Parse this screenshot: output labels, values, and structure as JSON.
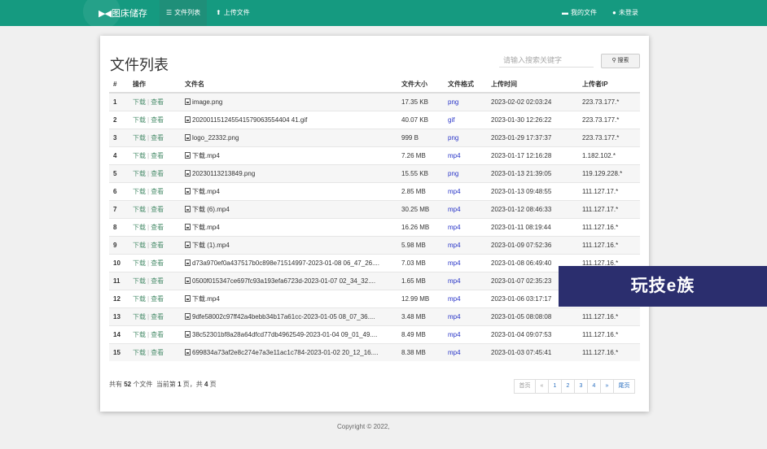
{
  "nav": {
    "brand_logo": "▶◀",
    "brand_text": "图床储存",
    "items": [
      {
        "label": "文件列表",
        "icon": "list-icon"
      },
      {
        "label": "上传文件",
        "icon": "upload-icon"
      }
    ],
    "right": [
      {
        "label": "我的文件",
        "icon": "folder-icon"
      },
      {
        "label": "未登录",
        "icon": "user-icon"
      }
    ]
  },
  "page": {
    "title": "文件列表",
    "search_placeholder": "请输入搜索关键字",
    "search_button": "搜索"
  },
  "table": {
    "headers": [
      "#",
      "操作",
      "文件名",
      "文件大小",
      "文件格式",
      "上传时间",
      "上传者IP"
    ],
    "download_label": "下载",
    "separator": "|",
    "view_label": "查看",
    "rows": [
      {
        "num": "1",
        "name": "image.png",
        "size": "17.35 KB",
        "format": "png",
        "time": "2023-02-02 02:03:24",
        "ip": "223.73.177.*"
      },
      {
        "num": "2",
        "name": "202001151245541579063554404 41.gif",
        "size": "40.07 KB",
        "format": "gif",
        "time": "2023-01-30 12:26:22",
        "ip": "223.73.177.*"
      },
      {
        "num": "3",
        "name": "logo_22332.png",
        "size": "999 B",
        "format": "png",
        "time": "2023-01-29 17:37:37",
        "ip": "223.73.177.*"
      },
      {
        "num": "4",
        "name": "下载.mp4",
        "size": "7.26 MB",
        "format": "mp4",
        "time": "2023-01-17 12:16:28",
        "ip": "1.182.102.*"
      },
      {
        "num": "5",
        "name": "20230113213849.png",
        "size": "15.55 KB",
        "format": "png",
        "time": "2023-01-13 21:39:05",
        "ip": "119.129.228.*"
      },
      {
        "num": "6",
        "name": "下载.mp4",
        "size": "2.85 MB",
        "format": "mp4",
        "time": "2023-01-13 09:48:55",
        "ip": "111.127.17.*"
      },
      {
        "num": "7",
        "name": "下载 (6).mp4",
        "size": "30.25 MB",
        "format": "mp4",
        "time": "2023-01-12 08:46:33",
        "ip": "111.127.17.*"
      },
      {
        "num": "8",
        "name": "下载.mp4",
        "size": "16.26 MB",
        "format": "mp4",
        "time": "2023-01-11 08:19:44",
        "ip": "111.127.16.*"
      },
      {
        "num": "9",
        "name": "下载 (1).mp4",
        "size": "5.98 MB",
        "format": "mp4",
        "time": "2023-01-09 07:52:36",
        "ip": "111.127.16.*"
      },
      {
        "num": "10",
        "name": "d73a970ef0a437517b0c898e71514997-2023-01-08 06_47_26....",
        "size": "7.03 MB",
        "format": "mp4",
        "time": "2023-01-08 06:49:40",
        "ip": "111.127.16.*"
      },
      {
        "num": "11",
        "name": "0500f015347ce697fc93a193efa6723d-2023-01-07 02_34_32....",
        "size": "1.65 MB",
        "format": "mp4",
        "time": "2023-01-07 02:35:23",
        "ip": ""
      },
      {
        "num": "12",
        "name": "下载.mp4",
        "size": "12.99 MB",
        "format": "mp4",
        "time": "2023-01-06 03:17:17",
        "ip": ""
      },
      {
        "num": "13",
        "name": "9dfe58002c97ff42a4bebb34b17a61cc-2023-01-05 08_07_36....",
        "size": "3.48 MB",
        "format": "mp4",
        "time": "2023-01-05 08:08:08",
        "ip": "111.127.16.*"
      },
      {
        "num": "14",
        "name": "38c52301bf8a28a64dfcd77db4962549-2023-01-04 09_01_49....",
        "size": "8.49 MB",
        "format": "mp4",
        "time": "2023-01-04 09:07:53",
        "ip": "111.127.16.*"
      },
      {
        "num": "15",
        "name": "699834a73af2e8c274e7a3e11ac1c784-2023-01-02 20_12_16....",
        "size": "8.38 MB",
        "format": "mp4",
        "time": "2023-01-03 07:45:41",
        "ip": "111.127.16.*"
      }
    ]
  },
  "footer": {
    "total_prefix": "共有",
    "total": "52",
    "total_suffix": "个文件",
    "current_prefix": "当前第",
    "current": "1",
    "current_suffix": "页，共",
    "pages": "4",
    "pages_suffix": "页"
  },
  "pagination": {
    "first": "首页",
    "prev": "«",
    "pages": [
      "1",
      "2",
      "3",
      "4"
    ],
    "next": "»",
    "last": "尾页"
  },
  "copyright": "Copyright © 2022, ",
  "watermark": "玩技e族",
  "colors": {
    "navbar": "#159a80",
    "link": "#4d8f6e",
    "format": "#2a36c8"
  }
}
